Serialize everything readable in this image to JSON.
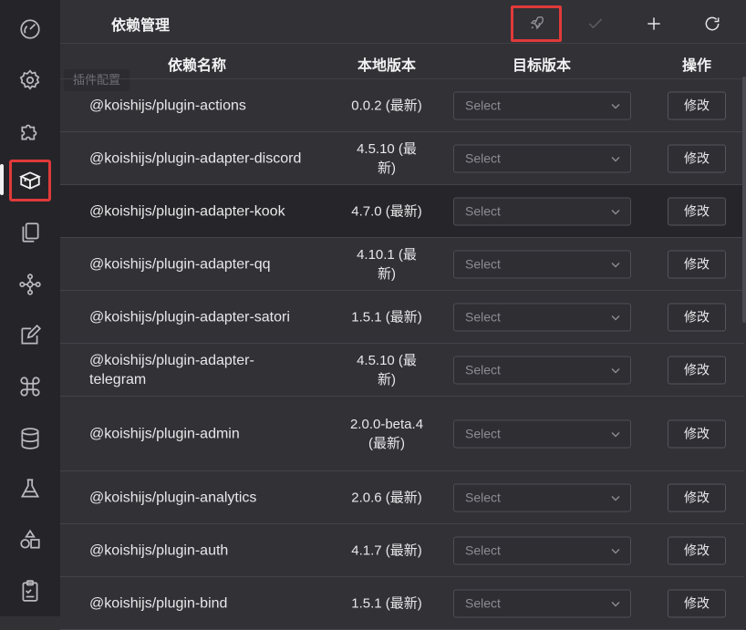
{
  "sidebar": {
    "icons": [
      {
        "name": "dashboard-icon"
      },
      {
        "name": "gear-icon"
      },
      {
        "name": "puzzle-icon"
      },
      {
        "name": "package-box-icon"
      },
      {
        "name": "files-icon"
      },
      {
        "name": "network-icon"
      },
      {
        "name": "edit-icon"
      },
      {
        "name": "command-icon"
      },
      {
        "name": "database-icon"
      },
      {
        "name": "flask-icon"
      },
      {
        "name": "shapes-icon"
      },
      {
        "name": "clipboard-icon"
      }
    ],
    "tooltip": "插件配置"
  },
  "header": {
    "title": "依赖管理",
    "actions": [
      "rocket-icon",
      "check-icon",
      "plus-icon",
      "refresh-icon"
    ]
  },
  "table": {
    "columns": {
      "name": "依赖名称",
      "local": "本地版本",
      "target": "目标版本",
      "action": "操作"
    },
    "select_placeholder": "Select",
    "edit_label": "修改",
    "rows": [
      {
        "name": "@koishijs/plugin-actions",
        "local": "0.0.2 (最新)"
      },
      {
        "name": "@koishijs/plugin-adapter-discord",
        "local": "4.5.10 (最新)"
      },
      {
        "name": "@koishijs/plugin-adapter-kook",
        "local": "4.7.0 (最新)"
      },
      {
        "name": "@koishijs/plugin-adapter-qq",
        "local": "4.10.1 (最新)"
      },
      {
        "name": "@koishijs/plugin-adapter-satori",
        "local": "1.5.1 (最新)"
      },
      {
        "name": "@koishijs/plugin-adapter-telegram",
        "local": "4.5.10 (最新)"
      },
      {
        "name": "@koishijs/plugin-admin",
        "local": "2.0.0-beta.4 (最新)"
      },
      {
        "name": "@koishijs/plugin-analytics",
        "local": "2.0.6 (最新)"
      },
      {
        "name": "@koishijs/plugin-auth",
        "local": "4.1.7 (最新)"
      },
      {
        "name": "@koishijs/plugin-bind",
        "local": "1.5.1 (最新)"
      }
    ]
  },
  "colors": {
    "highlight": "#e03a3a",
    "background": "#313136",
    "sidebar": "#252529"
  }
}
